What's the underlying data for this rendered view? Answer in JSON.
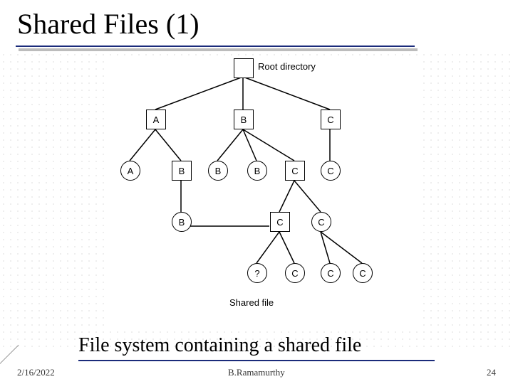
{
  "title": "Shared Files (1)",
  "subtitle": "File system containing a shared file",
  "footer": {
    "date": "2/16/2022",
    "author": "B.Ramamurthy",
    "page": "24"
  },
  "diagram": {
    "root_label": "Root directory",
    "shared_label": "Shared file",
    "nodes": {
      "root": "",
      "A1": "A",
      "B1": "B",
      "C1": "C",
      "A2": "A",
      "B2a": "B",
      "B2b": "B",
      "B2c": "B",
      "C2a": "C",
      "C2b": "C",
      "B3": "B",
      "C3a": "C",
      "C3b": "C",
      "Q": "?",
      "C4a": "C",
      "C4b": "C",
      "C4c": "C"
    }
  }
}
